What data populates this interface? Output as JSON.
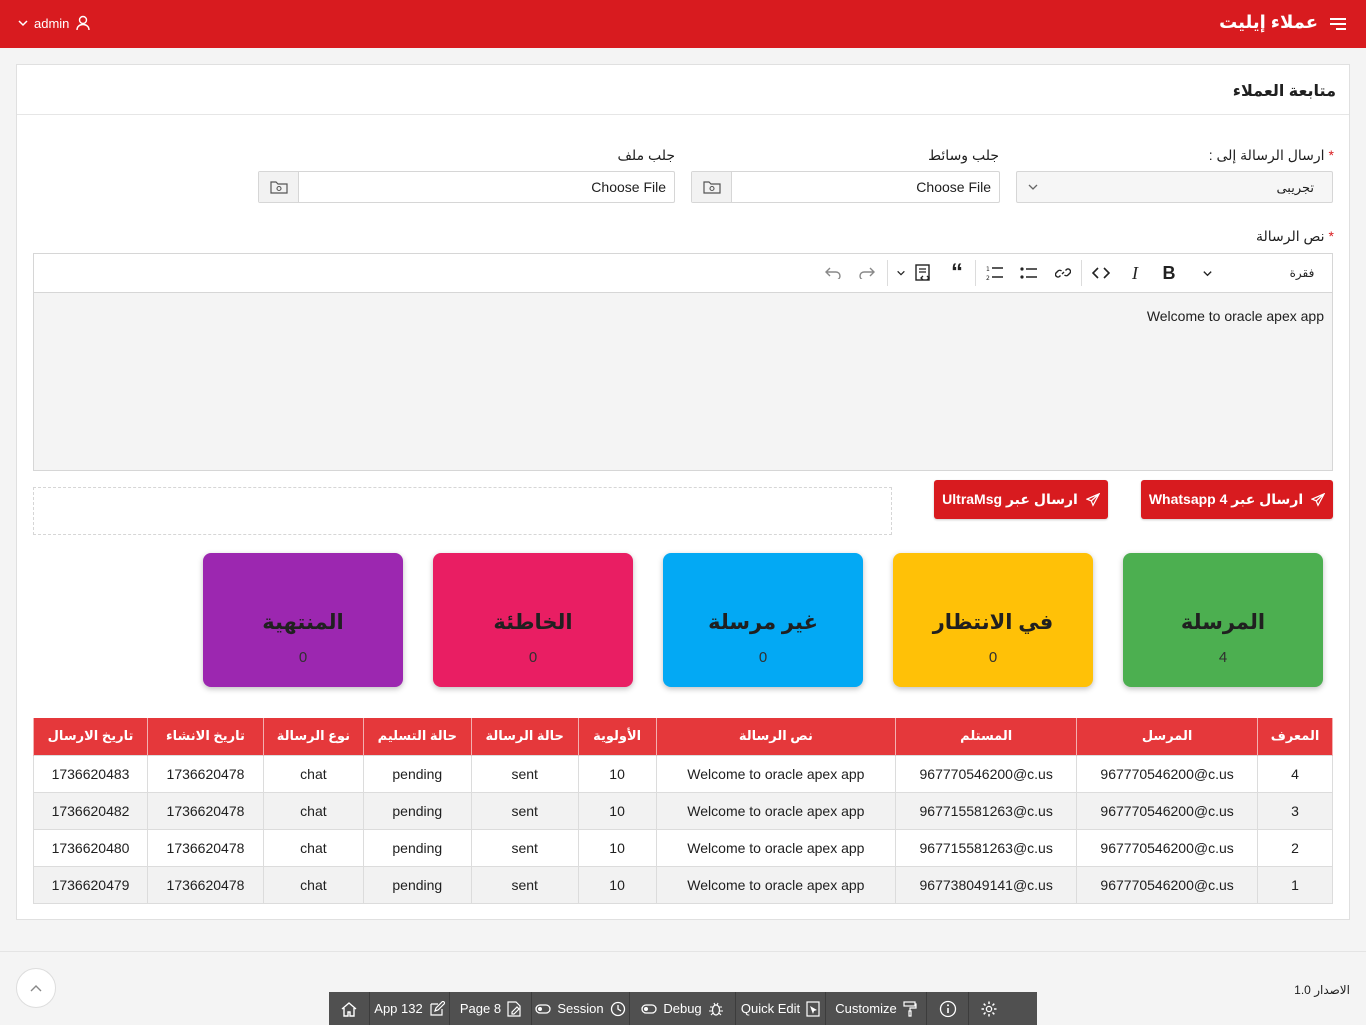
{
  "header": {
    "app_title": "عملاء إيليت",
    "user": "admin"
  },
  "region": {
    "title": "متابعة العملاء"
  },
  "form": {
    "send_to_label": "ارسال الرسالة إلى :",
    "send_to_value": "تجريبى",
    "media_label": "جلب وسائط",
    "file_label": "جلب ملف",
    "choose_file": "Choose File",
    "message_label": "نص الرسالة",
    "paragraph": "فقرة",
    "message_text": "Welcome to oracle apex app"
  },
  "buttons": {
    "whatsapp": "ارسال عبر Whatsapp 4",
    "ultramsg": "ارسال عبر UltraMsg"
  },
  "cards": [
    {
      "title": "المرسلة",
      "value": "4",
      "color": "#4caf50"
    },
    {
      "title": "في الانتظار",
      "value": "0",
      "color": "#ffc107"
    },
    {
      "title": "غير مرسلة",
      "value": "0",
      "color": "#03a9f4"
    },
    {
      "title": "الخاطئة",
      "value": "0",
      "color": "#e91e63"
    },
    {
      "title": "المنتهية",
      "value": "0",
      "color": "#9c27b0"
    }
  ],
  "table": {
    "headers": [
      "المعرف",
      "المرسل",
      "المستلم",
      "نص الرسالة",
      "الأولوية",
      "حالة الرسالة",
      "حالة التسليم",
      "نوع الرسالة",
      "تاريخ الانشاء",
      "تاريخ الارسال"
    ],
    "rows": [
      [
        "4",
        "967770546200@c.us",
        "967770546200@c.us",
        "Welcome to oracle apex app",
        "10",
        "sent",
        "pending",
        "chat",
        "1736620478",
        "1736620483"
      ],
      [
        "3",
        "967770546200@c.us",
        "967715581263@c.us",
        "Welcome to oracle apex app",
        "10",
        "sent",
        "pending",
        "chat",
        "1736620478",
        "1736620482"
      ],
      [
        "2",
        "967770546200@c.us",
        "967715581263@c.us",
        "Welcome to oracle apex app",
        "10",
        "sent",
        "pending",
        "chat",
        "1736620478",
        "1736620480"
      ],
      [
        "1",
        "967770546200@c.us",
        "967738049141@c.us",
        "Welcome to oracle apex app",
        "10",
        "sent",
        "pending",
        "chat",
        "1736620478",
        "1736620479"
      ]
    ]
  },
  "footer": {
    "version": "الاصدار 1.0"
  },
  "devbar": {
    "customize": "Customize",
    "quick_edit": "Quick Edit",
    "debug": "Debug",
    "session": "Session",
    "page": "Page 8",
    "app": "App 132"
  }
}
